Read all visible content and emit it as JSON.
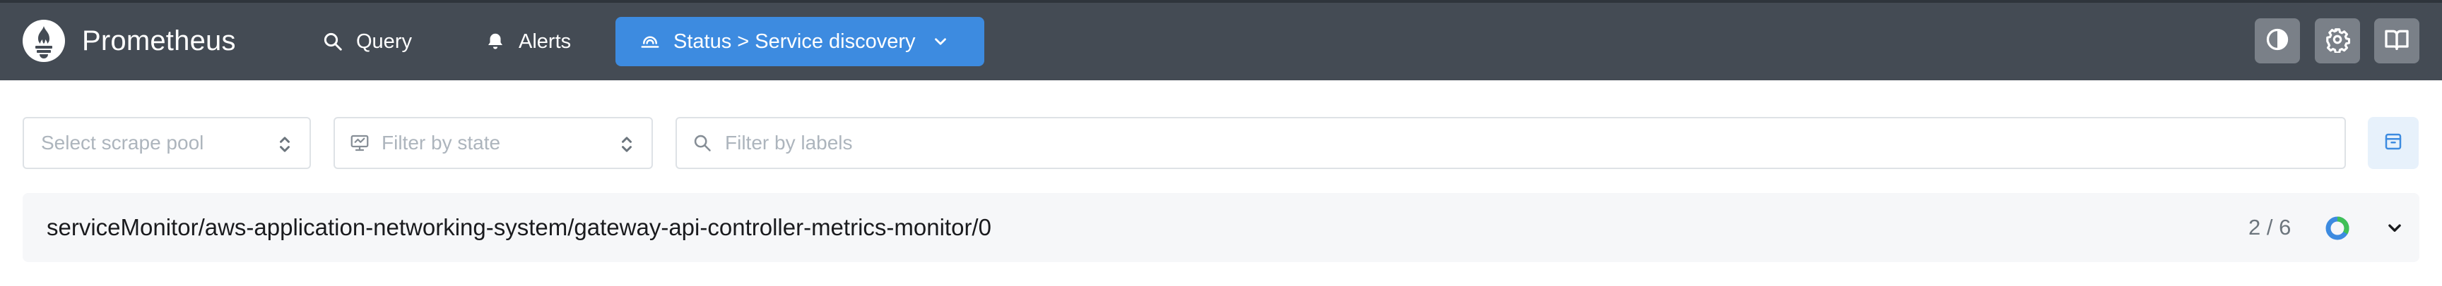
{
  "app": {
    "name": "Prometheus"
  },
  "nav": {
    "query_label": "Query",
    "alerts_label": "Alerts",
    "status_label": "Status > Service discovery"
  },
  "toolbar": {
    "theme_icon": "contrast-icon",
    "settings_icon": "gear-icon",
    "docs_icon": "book-icon"
  },
  "filters": {
    "scrape_pool_placeholder": "Select scrape pool",
    "state_placeholder": "Filter by state",
    "labels_placeholder": "Filter by labels"
  },
  "pools": [
    {
      "name": "serviceMonitor/aws-application-networking-system/gateway-api-controller-metrics-monitor/0",
      "count": "2 / 6",
      "healthy_fraction": 0.333
    }
  ],
  "colors": {
    "navbar": "#444b54",
    "accent": "#3d8be0",
    "ring_blue": "#3d8be0",
    "ring_green": "#40c057"
  }
}
